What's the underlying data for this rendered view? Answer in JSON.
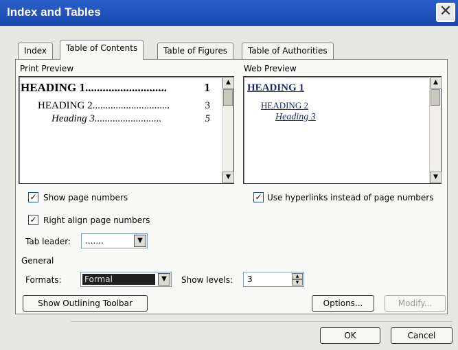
{
  "window": {
    "title": "Index and Tables",
    "close_glyph": "✕"
  },
  "tabs": [
    {
      "label": "Index",
      "active": false
    },
    {
      "label": "Table of Contents",
      "active": true
    },
    {
      "label": "Table of Figures",
      "active": false
    },
    {
      "label": "Table of Authorities",
      "active": false
    }
  ],
  "print_preview": {
    "label": "Print Preview",
    "heading1": "HEADING 1",
    "dots1": "............................",
    "num1": "1",
    "heading2": "HEADING 2",
    "dots2": "..............................",
    "num2": "3",
    "heading3": "Heading 3",
    "dots3": "..........................",
    "num3": "5"
  },
  "web_preview": {
    "label": "Web Preview",
    "heading1": "HEADING 1",
    "heading2": "HEADING 2",
    "heading3": "Heading 3"
  },
  "options": {
    "show_page_numbers": {
      "label": "Show page numbers",
      "checked": true
    },
    "right_align": {
      "label": "Right align page numbers",
      "checked": true
    },
    "hyperlinks": {
      "label": "Use hyperlinks instead of page numbers",
      "checked": true
    },
    "tab_leader": {
      "label": "Tab leader:",
      "value": "......."
    }
  },
  "general": {
    "label": "General",
    "formats": {
      "label": "Formats:",
      "value": "Formal"
    },
    "show_levels": {
      "label": "Show levels:",
      "value": "3"
    }
  },
  "buttons": {
    "outlining": "Show Outlining Toolbar",
    "options": "Options...",
    "modify": "Modify...",
    "ok": "OK",
    "cancel": "Cancel"
  },
  "icons": {
    "check": "✓",
    "scroll_up": "▲",
    "scroll_down": "▼",
    "dropdown": "▼",
    "spin_up": "▲",
    "spin_down": "▼"
  }
}
